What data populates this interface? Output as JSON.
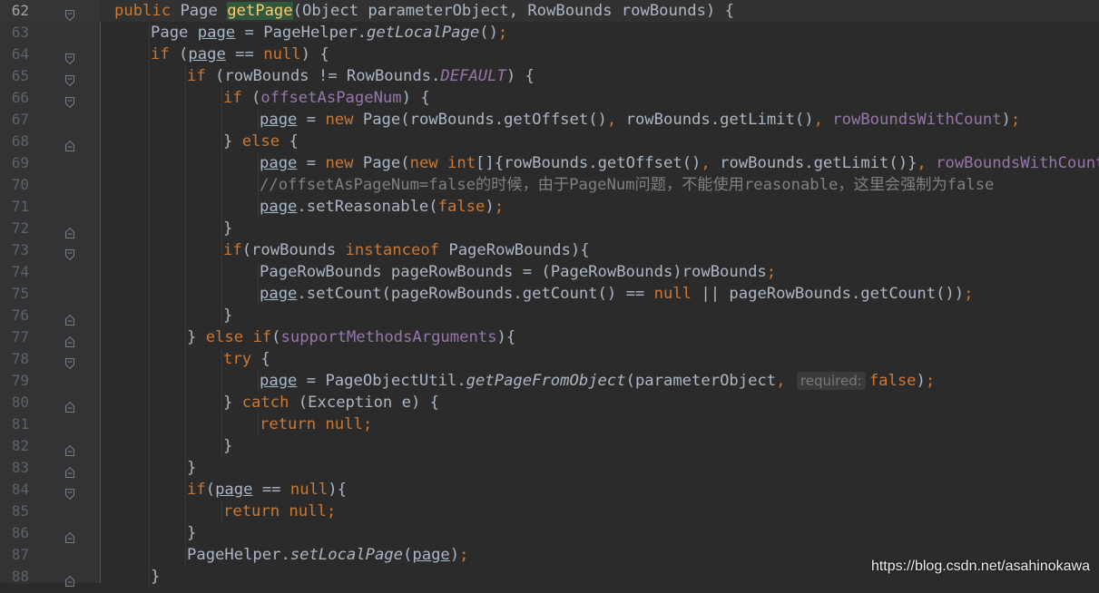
{
  "editor": {
    "current_line": 62,
    "lines": [
      {
        "n": "62",
        "indent": 1,
        "fold": "open",
        "parts": [
          {
            "t": "public ",
            "c": "kw"
          },
          {
            "t": "Page "
          },
          {
            "t": "getPage",
            "c": "hl"
          },
          {
            "t": "(Object parameterObject, RowBounds rowBounds) {"
          }
        ]
      },
      {
        "n": "63",
        "indent": 2,
        "fold": "none",
        "parts": [
          {
            "t": "Page "
          },
          {
            "t": "page",
            "c": "ul"
          },
          {
            "t": " = PageHelper."
          },
          {
            "t": "getLocalPage",
            "c": "it"
          },
          {
            "t": "()"
          },
          {
            "t": ";",
            "c": "kw"
          }
        ]
      },
      {
        "n": "64",
        "indent": 2,
        "fold": "open",
        "parts": [
          {
            "t": "if ",
            "c": "kw"
          },
          {
            "t": "("
          },
          {
            "t": "page",
            "c": "ul"
          },
          {
            "t": " == "
          },
          {
            "t": "null",
            "c": "kw"
          },
          {
            "t": ") {"
          }
        ]
      },
      {
        "n": "65",
        "indent": 3,
        "fold": "open",
        "parts": [
          {
            "t": "if ",
            "c": "kw"
          },
          {
            "t": "(rowBounds != RowBounds."
          },
          {
            "t": "DEFAULT",
            "c": "fld it"
          },
          {
            "t": ") {"
          }
        ]
      },
      {
        "n": "66",
        "indent": 4,
        "fold": "open",
        "parts": [
          {
            "t": "if ",
            "c": "kw"
          },
          {
            "t": "("
          },
          {
            "t": "offsetAsPageNum",
            "c": "fld"
          },
          {
            "t": ") {"
          }
        ]
      },
      {
        "n": "67",
        "indent": 5,
        "fold": "none",
        "parts": [
          {
            "t": "page",
            "c": "ul"
          },
          {
            "t": " = "
          },
          {
            "t": "new ",
            "c": "kw"
          },
          {
            "t": "Page(rowBounds.getOffset()"
          },
          {
            "t": ", ",
            "c": "kw"
          },
          {
            "t": "rowBounds.getLimit()"
          },
          {
            "t": ", ",
            "c": "kw"
          },
          {
            "t": "rowBoundsWithCount",
            "c": "fld"
          },
          {
            "t": ")"
          },
          {
            "t": ";",
            "c": "kw"
          }
        ]
      },
      {
        "n": "68",
        "indent": 4,
        "fold": "close",
        "parts": [
          {
            "t": "} "
          },
          {
            "t": "else ",
            "c": "kw"
          },
          {
            "t": "{"
          }
        ]
      },
      {
        "n": "69",
        "indent": 5,
        "fold": "none",
        "parts": [
          {
            "t": "page",
            "c": "ul"
          },
          {
            "t": " = "
          },
          {
            "t": "new ",
            "c": "kw"
          },
          {
            "t": "Page("
          },
          {
            "t": "new int",
            "c": "kw"
          },
          {
            "t": "[]{rowBounds.getOffset()"
          },
          {
            "t": ", ",
            "c": "kw"
          },
          {
            "t": "rowBounds.getLimit()}"
          },
          {
            "t": ", ",
            "c": "kw"
          },
          {
            "t": "rowBoundsWithCount",
            "c": "fld"
          },
          {
            "t": ")"
          },
          {
            "t": ";",
            "c": "kw"
          }
        ]
      },
      {
        "n": "70",
        "indent": 5,
        "fold": "none",
        "parts": [
          {
            "t": "//offsetAsPageNum=false的时候，由于PageNum问题，不能使用reasonable，这里会强制为false",
            "c": "cmt"
          }
        ]
      },
      {
        "n": "71",
        "indent": 5,
        "fold": "none",
        "parts": [
          {
            "t": "page",
            "c": "ul"
          },
          {
            "t": ".setReasonable("
          },
          {
            "t": "false",
            "c": "kw"
          },
          {
            "t": ")"
          },
          {
            "t": ";",
            "c": "kw"
          }
        ]
      },
      {
        "n": "72",
        "indent": 4,
        "fold": "close",
        "parts": [
          {
            "t": "}"
          }
        ]
      },
      {
        "n": "73",
        "indent": 4,
        "fold": "open",
        "parts": [
          {
            "t": "if",
            "c": "kw"
          },
          {
            "t": "(rowBounds "
          },
          {
            "t": "instanceof ",
            "c": "kw"
          },
          {
            "t": "PageRowBounds){"
          }
        ]
      },
      {
        "n": "74",
        "indent": 5,
        "fold": "none",
        "parts": [
          {
            "t": "PageRowBounds pageRowBounds = (PageRowBounds)rowBounds"
          },
          {
            "t": ";",
            "c": "kw"
          }
        ]
      },
      {
        "n": "75",
        "indent": 5,
        "fold": "none",
        "parts": [
          {
            "t": "page",
            "c": "ul"
          },
          {
            "t": ".setCount(pageRowBounds.getCount() == "
          },
          {
            "t": "null ",
            "c": "kw"
          },
          {
            "t": "|| pageRowBounds.getCount())"
          },
          {
            "t": ";",
            "c": "kw"
          }
        ]
      },
      {
        "n": "76",
        "indent": 4,
        "fold": "close",
        "parts": [
          {
            "t": "}"
          }
        ]
      },
      {
        "n": "77",
        "indent": 3,
        "fold": "close",
        "parts": [
          {
            "t": "} "
          },
          {
            "t": "else if",
            "c": "kw"
          },
          {
            "t": "("
          },
          {
            "t": "supportMethodsArguments",
            "c": "fld"
          },
          {
            "t": "){"
          }
        ]
      },
      {
        "n": "78",
        "indent": 4,
        "fold": "open",
        "parts": [
          {
            "t": "try ",
            "c": "kw"
          },
          {
            "t": "{"
          }
        ]
      },
      {
        "n": "79",
        "indent": 5,
        "fold": "none",
        "parts": [
          {
            "t": "page",
            "c": "ul"
          },
          {
            "t": " = PageObjectUtil."
          },
          {
            "t": "getPageFromObject",
            "c": "it"
          },
          {
            "t": "(parameterObject"
          },
          {
            "t": ", ",
            "c": "kw"
          },
          {
            "hint": "required:"
          },
          {
            "t": "false",
            "c": "kw"
          },
          {
            "t": ")"
          },
          {
            "t": ";",
            "c": "kw"
          }
        ]
      },
      {
        "n": "80",
        "indent": 4,
        "fold": "close",
        "parts": [
          {
            "t": "} "
          },
          {
            "t": "catch ",
            "c": "kw"
          },
          {
            "t": "(Exception e) {"
          }
        ]
      },
      {
        "n": "81",
        "indent": 5,
        "fold": "none",
        "parts": [
          {
            "t": "return null;",
            "c": "kw"
          }
        ]
      },
      {
        "n": "82",
        "indent": 4,
        "fold": "close",
        "parts": [
          {
            "t": "}"
          }
        ]
      },
      {
        "n": "83",
        "indent": 3,
        "fold": "close",
        "parts": [
          {
            "t": "}"
          }
        ]
      },
      {
        "n": "84",
        "indent": 3,
        "fold": "open",
        "parts": [
          {
            "t": "if",
            "c": "kw"
          },
          {
            "t": "("
          },
          {
            "t": "page",
            "c": "ul"
          },
          {
            "t": " == "
          },
          {
            "t": "null",
            "c": "kw"
          },
          {
            "t": "){"
          }
        ]
      },
      {
        "n": "85",
        "indent": 4,
        "fold": "none",
        "parts": [
          {
            "t": "return null;",
            "c": "kw"
          }
        ]
      },
      {
        "n": "86",
        "indent": 3,
        "fold": "close",
        "parts": [
          {
            "t": "}"
          }
        ]
      },
      {
        "n": "87",
        "indent": 3,
        "fold": "none",
        "parts": [
          {
            "t": "PageHelper."
          },
          {
            "t": "setLocalPage",
            "c": "it"
          },
          {
            "t": "("
          },
          {
            "t": "page",
            "c": "ul"
          },
          {
            "t": ")"
          },
          {
            "t": ";",
            "c": "kw"
          }
        ]
      },
      {
        "n": "88",
        "indent": 2,
        "fold": "close",
        "parts": [
          {
            "t": "}"
          }
        ]
      }
    ]
  },
  "watermark": "https://blog.csdn.net/asahinokawa",
  "colors": {
    "background": "#2b2b2b",
    "gutter": "#313335",
    "keyword": "#cc7832",
    "method_declaration": "#ffc66d",
    "field": "#9876aa",
    "comment": "#808080",
    "plain": "#a9b7c6"
  }
}
